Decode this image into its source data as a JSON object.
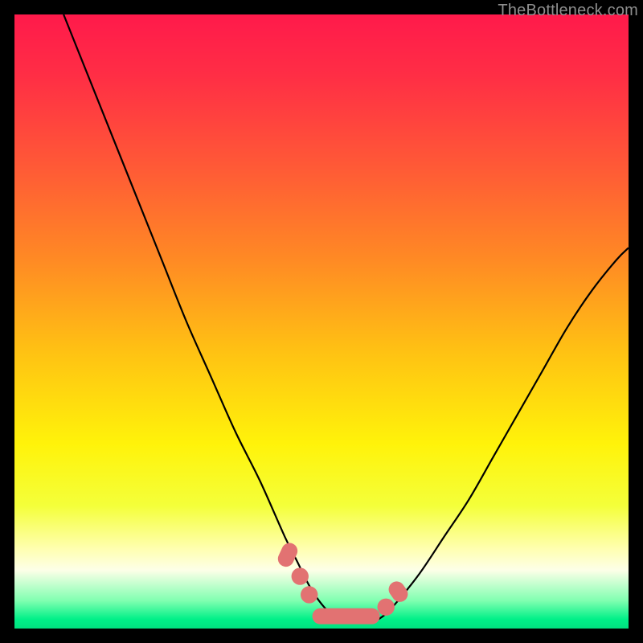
{
  "watermark": "TheBottleneck.com",
  "colors": {
    "gradient_stops": [
      {
        "offset": 0.0,
        "color": "#ff1a4b"
      },
      {
        "offset": 0.1,
        "color": "#ff2e45"
      },
      {
        "offset": 0.25,
        "color": "#ff5a36"
      },
      {
        "offset": 0.4,
        "color": "#ff8a24"
      },
      {
        "offset": 0.55,
        "color": "#ffc213"
      },
      {
        "offset": 0.7,
        "color": "#fff30a"
      },
      {
        "offset": 0.8,
        "color": "#f4ff3a"
      },
      {
        "offset": 0.87,
        "color": "#ffffb0"
      },
      {
        "offset": 0.905,
        "color": "#fdffe8"
      },
      {
        "offset": 0.955,
        "color": "#7fffb0"
      },
      {
        "offset": 0.985,
        "color": "#00f088"
      },
      {
        "offset": 1.0,
        "color": "#00e07f"
      }
    ],
    "curve": "#000000",
    "marker_fill": "#e27272",
    "marker_stroke": "#c05555"
  },
  "chart_data": {
    "type": "line",
    "title": "",
    "xlabel": "",
    "ylabel": "",
    "xlim": [
      0,
      100
    ],
    "ylim": [
      0,
      100
    ],
    "series": [
      {
        "name": "bottleneck-curve",
        "x": [
          8,
          12,
          16,
          20,
          24,
          28,
          32,
          36,
          40,
          44,
          46,
          48,
          50,
          52,
          54,
          56,
          58,
          60,
          62,
          66,
          70,
          74,
          78,
          82,
          86,
          90,
          94,
          98,
          100
        ],
        "y": [
          100,
          90,
          80,
          70,
          60,
          50,
          41,
          32,
          24,
          15,
          11,
          7,
          4,
          2,
          1,
          1,
          1,
          2,
          4,
          9,
          15,
          21,
          28,
          35,
          42,
          49,
          55,
          60,
          62
        ]
      }
    ],
    "markers": [
      {
        "kind": "pill",
        "x": 44.5,
        "y": 12,
        "len": 4,
        "angle": -65
      },
      {
        "kind": "circle",
        "x": 46.5,
        "y": 8.5,
        "r": 1.4
      },
      {
        "kind": "circle",
        "x": 48.0,
        "y": 5.5,
        "r": 1.4
      },
      {
        "kind": "pill",
        "x": 54.0,
        "y": 2.0,
        "len": 11,
        "angle": 0
      },
      {
        "kind": "circle",
        "x": 60.5,
        "y": 3.5,
        "r": 1.4
      },
      {
        "kind": "pill",
        "x": 62.5,
        "y": 6.0,
        "len": 3.5,
        "angle": 55
      }
    ]
  }
}
